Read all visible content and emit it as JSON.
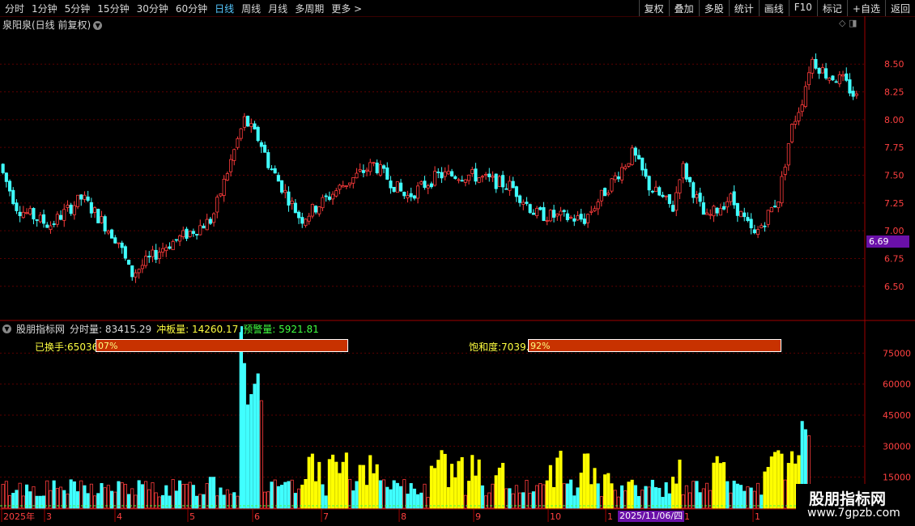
{
  "toolbar": {
    "periods": [
      "分时",
      "1分钟",
      "5分钟",
      "15分钟",
      "30分钟",
      "60分钟",
      "日线",
      "周线",
      "月线",
      "多周期",
      "更多 >"
    ],
    "active_period": "日线",
    "actions": [
      "复权",
      "叠加",
      "多股",
      "统计",
      "画线",
      "F10",
      "标记",
      "+自选",
      "返回"
    ]
  },
  "price_panel": {
    "title": "泉阳泉(日线 前复权)",
    "y_ticks": [
      "8.50",
      "8.25",
      "8.00",
      "7.75",
      "7.50",
      "7.25",
      "7.00",
      "6.75",
      "6.50"
    ],
    "current_price": "6.69",
    "icons": [
      "diamond-icon",
      "window-icon"
    ]
  },
  "indicator_panel": {
    "name": "股朋指标网",
    "fen_label": "分时量: 83415.29",
    "chong_label": "冲板量: 14260.17",
    "yujing_label": "预警量: 5921.81",
    "y_ticks": [
      "75000",
      "60000",
      "45000",
      "30000",
      "15000"
    ],
    "left_bar_label": "已换手:65036",
    "left_bar_text": "07%",
    "right_bar_label": "饱和度:7039.",
    "right_bar_text": "92%"
  },
  "x_axis": {
    "labels": [
      "2025年",
      "3",
      "4",
      "5",
      "6",
      "7",
      "8",
      "9",
      "10",
      "1",
      "1",
      "1"
    ],
    "highlight_date": "2025/11/06/四"
  },
  "watermark": {
    "line1": "股朋指标网",
    "line2": "www.7gpzb.com"
  },
  "colors": {
    "up": "#ff3c3c",
    "down": "#40ffff",
    "volume_up": "#ff4040",
    "volume_yellow": "#ffff00",
    "grid": "#5a0000",
    "axis_text": "#ff4040",
    "tag_bg": "#6a10a8"
  },
  "chart_data": [
    {
      "type": "candlestick",
      "y_ticks": [
        6.5,
        6.75,
        7.0,
        7.25,
        7.5,
        7.75,
        8.0,
        8.25,
        8.5
      ],
      "ylim": [
        6.2,
        8.8
      ],
      "last": 8.2
    },
    {
      "type": "bar",
      "y_ticks": [
        15000,
        30000,
        45000,
        60000,
        75000
      ],
      "ylim": [
        0,
        90000
      ]
    }
  ]
}
